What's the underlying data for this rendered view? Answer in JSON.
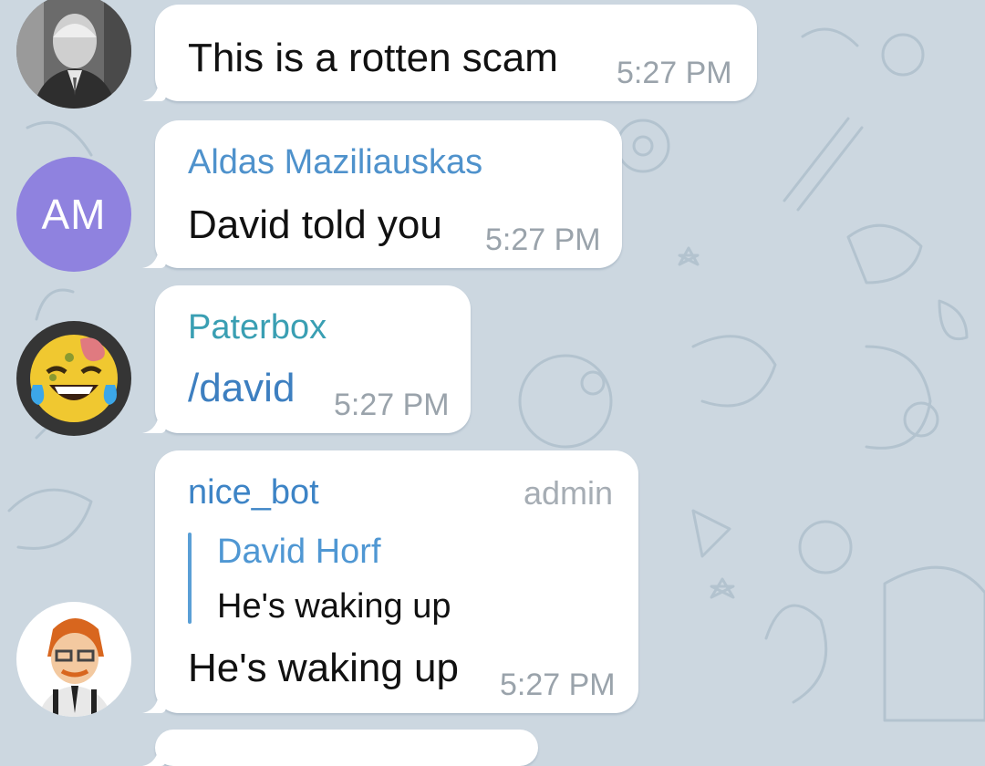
{
  "colors": {
    "background": "#ccd7e0",
    "bubble": "#ffffff",
    "sender_aldas": "#4f92cc",
    "sender_paterbox": "#3a9fb3",
    "sender_nice_bot": "#3d84c6",
    "reply_accent": "#5a9fd6",
    "timestamp": "#9aa3ab",
    "initials_avatar": "#8f82df"
  },
  "messages": [
    {
      "avatar_icon": "elderly-man-photo-icon",
      "text": "This is a rotten scam",
      "time": "5:27 PM"
    },
    {
      "sender": "Aldas Maziliauskas",
      "avatar_initials": "AM",
      "text": "David told you",
      "time": "5:27 PM"
    },
    {
      "sender": "Paterbox",
      "avatar_icon": "zombie-laughing-emoji-icon",
      "text": "/david",
      "time": "5:27 PM"
    },
    {
      "sender": "nice_bot",
      "role_badge": "admin",
      "reply": {
        "name": "David Horf",
        "text": "He's waking up"
      },
      "avatar_icon": "cartoon-character-icon",
      "text": "He's waking up",
      "time": "5:27 PM"
    }
  ]
}
